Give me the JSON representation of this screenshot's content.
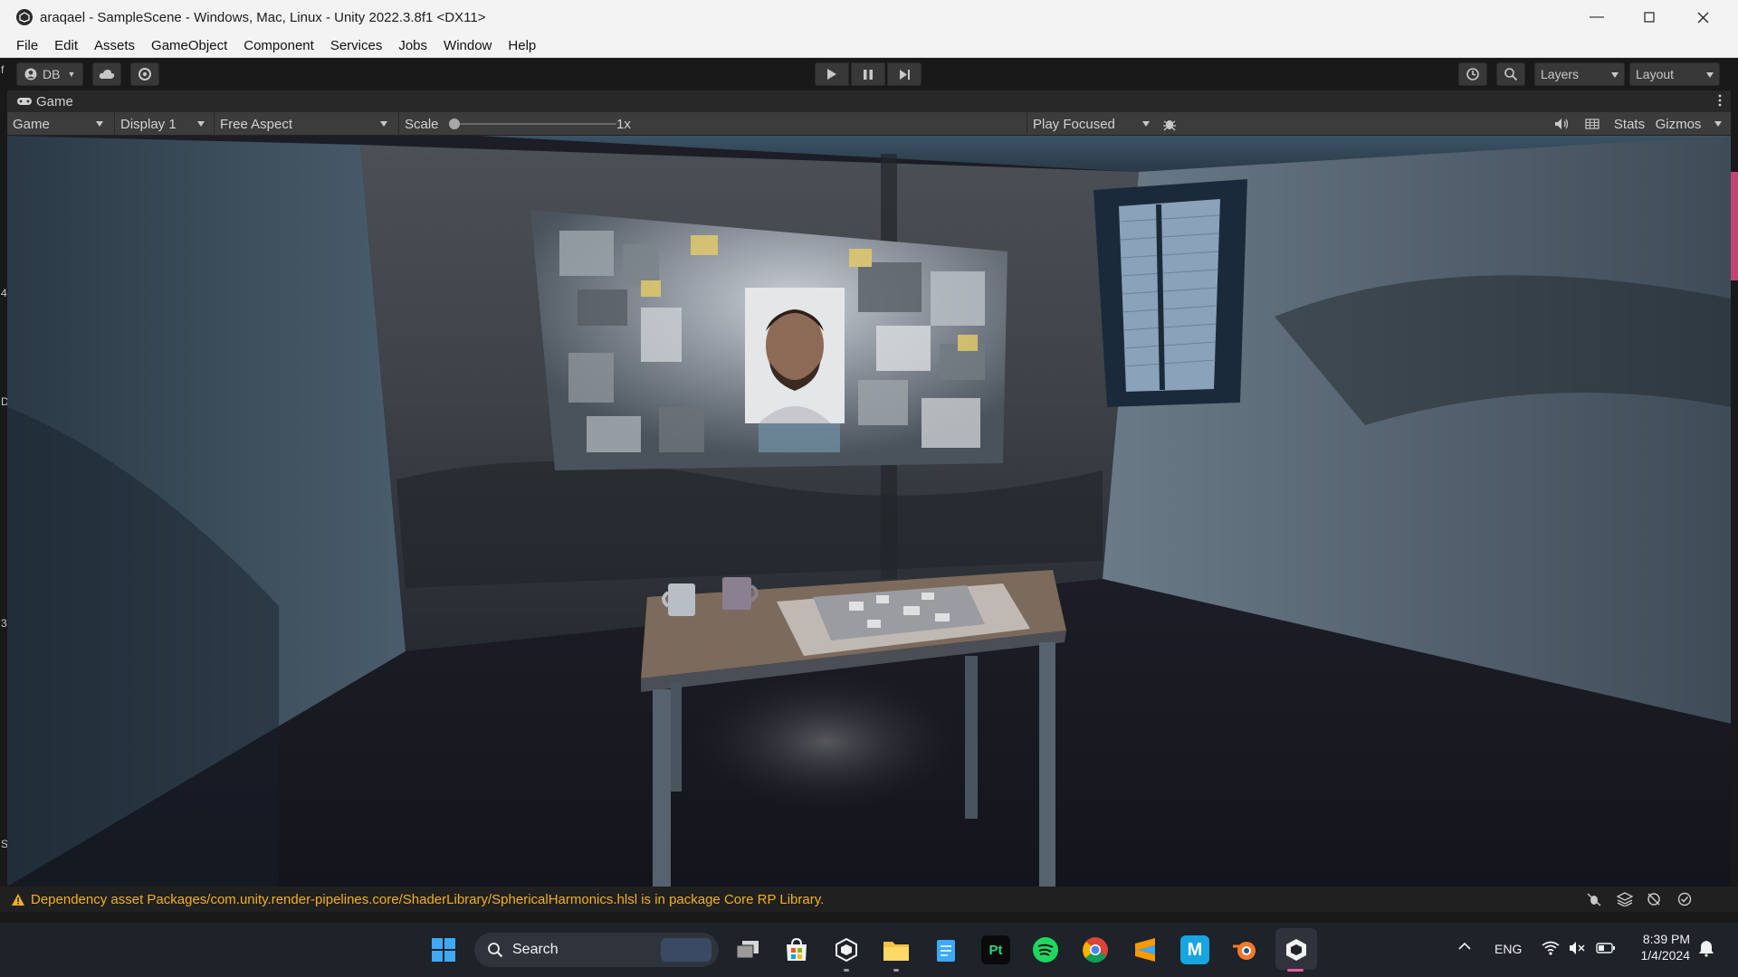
{
  "window": {
    "title": "araqael - SampleScene - Windows, Mac, Linux - Unity 2022.3.8f1 <DX11>"
  },
  "menu": [
    "File",
    "Edit",
    "Assets",
    "GameObject",
    "Component",
    "Services",
    "Jobs",
    "Window",
    "Help"
  ],
  "toolbar": {
    "account_label": "DB",
    "layers_label": "Layers",
    "layout_label": "Layout"
  },
  "game_tab": {
    "label": "Game"
  },
  "game_toolbar": {
    "view_label": "Game",
    "display_label": "Display 1",
    "aspect_label": "Free Aspect",
    "scale_label": "Scale",
    "scale_value": "1x",
    "play_mode_label": "Play Focused",
    "stats_label": "Stats",
    "gizmos_label": "Gizmos"
  },
  "status": {
    "message": "Dependency asset Packages/com.unity.render-pipelines.core/ShaderLibrary/SphericalHarmonics.hlsl is in package Core RP Library."
  },
  "side_marks": [
    "f",
    "4",
    "D",
    "3",
    "S"
  ],
  "taskbar": {
    "search_placeholder": "Search",
    "language": "ENG",
    "time": "8:39 PM",
    "date": "1/4/2024",
    "apps": [
      "windows-start",
      "search",
      "task-view",
      "microsoft-store",
      "unity-hub",
      "file-explorer",
      "notepad",
      "pycharm",
      "spotify",
      "chrome",
      "sublime",
      "msi",
      "blender",
      "unity"
    ],
    "pycharm_label": "Pt",
    "maya_label": "M"
  },
  "colors": {
    "warning": "#f2b01d",
    "unity_dark": "#191919",
    "accent_pink": "#e85aa5"
  }
}
